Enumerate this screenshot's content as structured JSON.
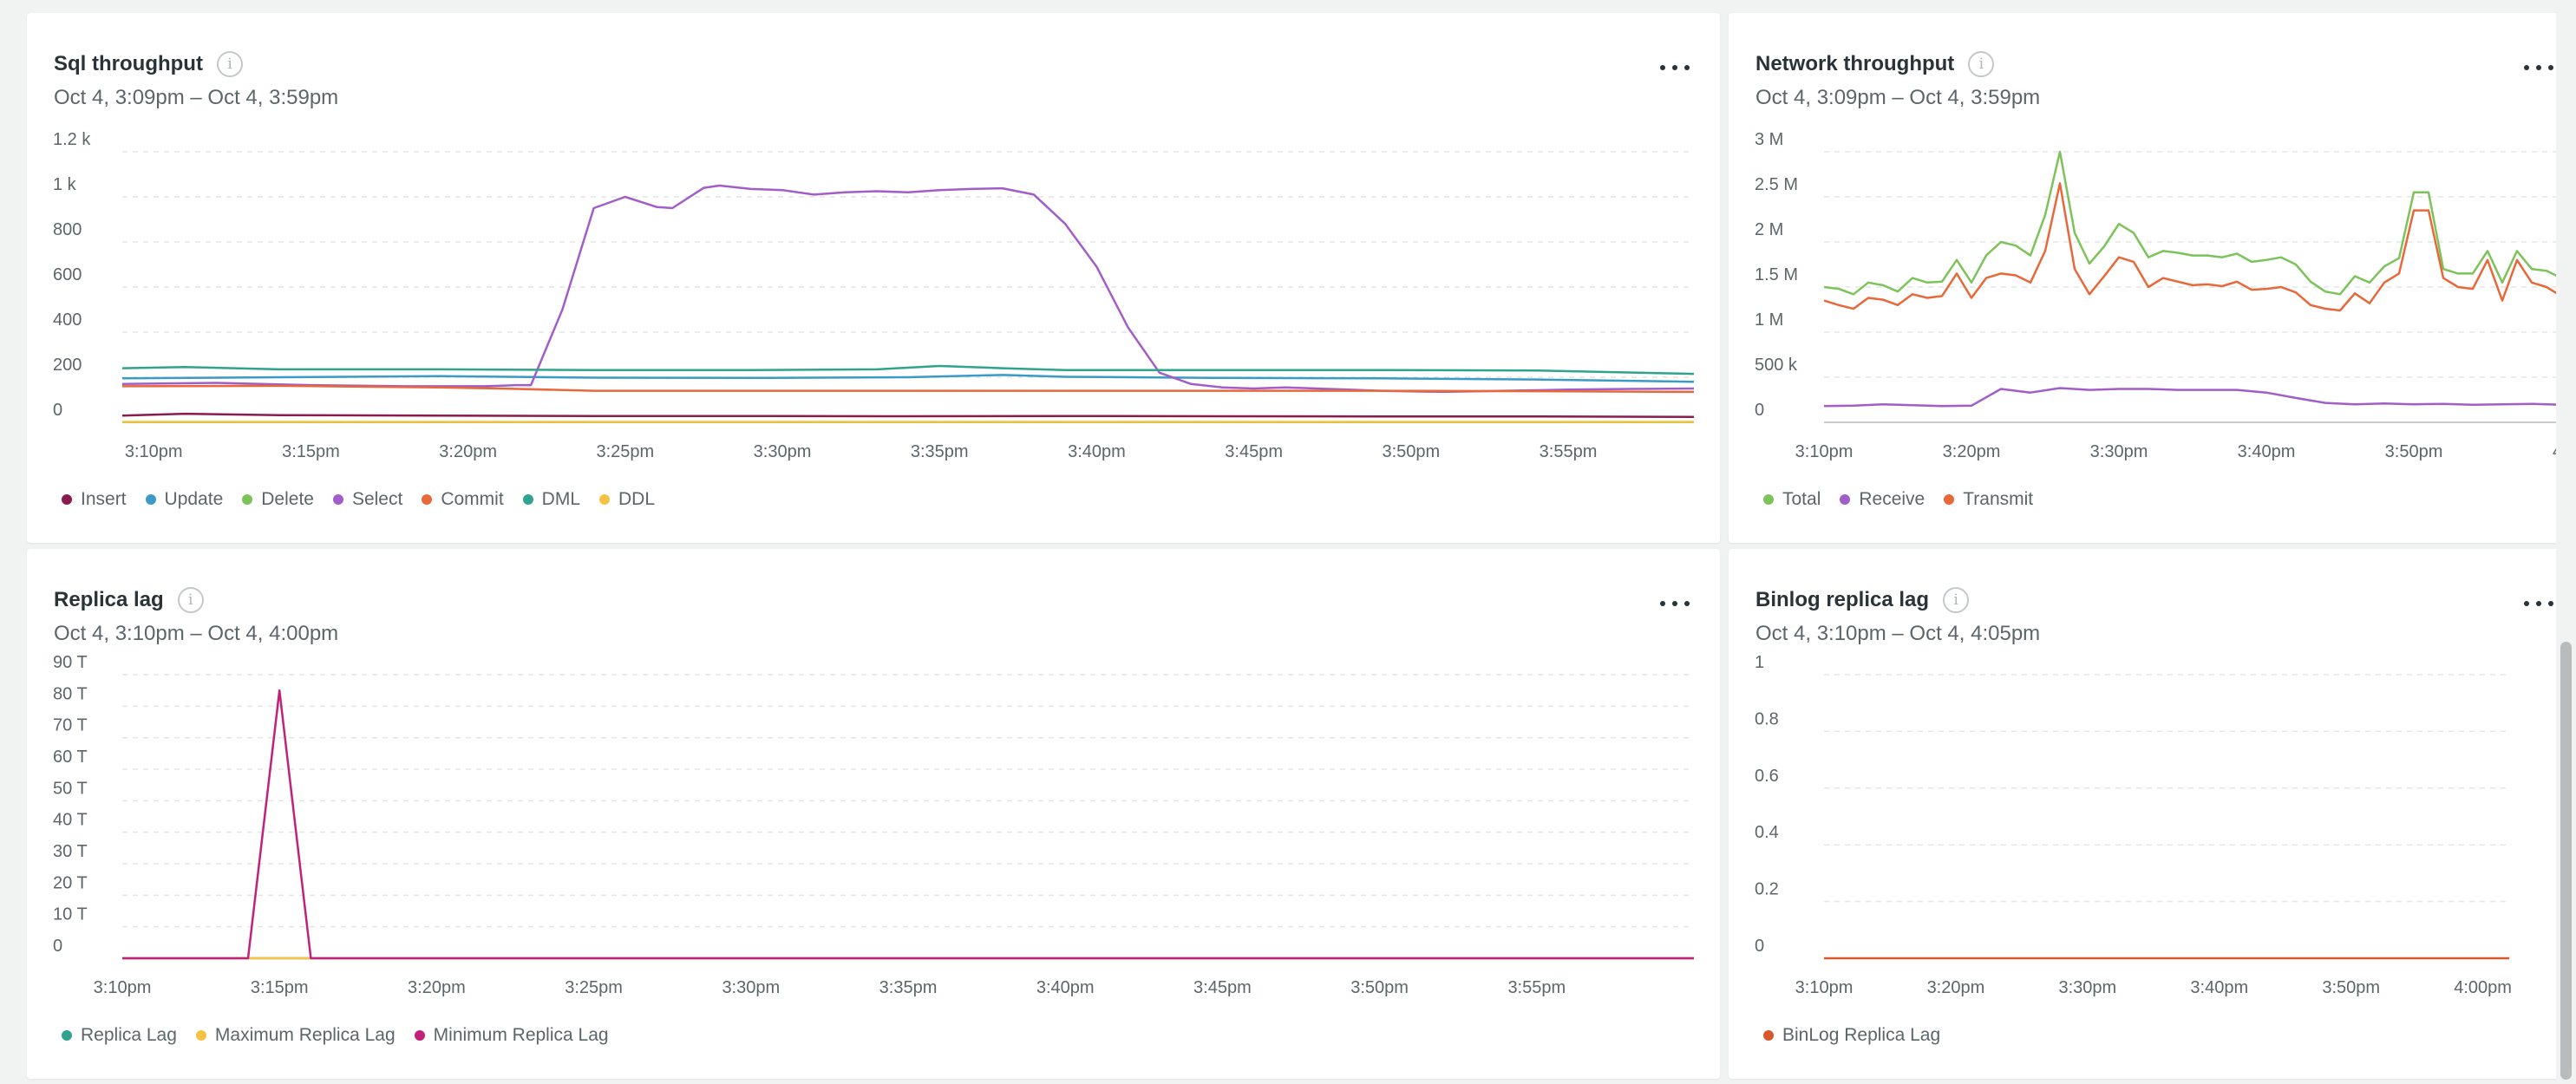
{
  "panels": {
    "sql": {
      "title": "Sql throughput",
      "subtitle": "Oct 4, 3:09pm – Oct 4, 3:59pm"
    },
    "network": {
      "title": "Network throughput",
      "subtitle": "Oct 4, 3:09pm – Oct 4, 3:59pm"
    },
    "replica": {
      "title": "Replica lag",
      "subtitle": "Oct 4, 3:10pm – Oct 4, 4:00pm"
    },
    "binlog": {
      "title": "Binlog replica lag",
      "subtitle": "Oct 4, 3:10pm – Oct 4, 4:05pm"
    }
  },
  "icons": {
    "info": "info-icon",
    "more": "more-horizontal-icon"
  },
  "chart_data": [
    {
      "id": "sql",
      "type": "line",
      "ylim": [
        0,
        1200
      ],
      "yticks": [
        0,
        200,
        400,
        600,
        800,
        1000,
        1200
      ],
      "ytick_labels": [
        "0",
        "200",
        "400",
        "600",
        "800",
        "1 k",
        "1.2 k"
      ],
      "xlim": [
        0,
        50
      ],
      "xticks": [
        1,
        6,
        11,
        16,
        21,
        26,
        31,
        36,
        41,
        46
      ],
      "xtick_labels": [
        "3:10pm",
        "3:15pm",
        "3:20pm",
        "3:25pm",
        "3:30pm",
        "3:35pm",
        "3:40pm",
        "3:45pm",
        "3:50pm",
        "3:55pm"
      ],
      "grid": true,
      "series": [
        {
          "name": "Insert",
          "color": "#8b1b4f",
          "x": [
            0,
            2,
            5,
            10,
            15,
            20,
            25,
            30,
            35,
            40,
            45,
            50
          ],
          "y": [
            30,
            38,
            32,
            30,
            28,
            28,
            27,
            28,
            27,
            26,
            26,
            24
          ]
        },
        {
          "name": "Update",
          "color": "#3b9ac6",
          "x": [
            0,
            5,
            10,
            15,
            20,
            25,
            28,
            30,
            35,
            40,
            45,
            50
          ],
          "y": [
            195,
            200,
            205,
            198,
            197,
            200,
            210,
            202,
            197,
            195,
            190,
            180
          ]
        },
        {
          "name": "Delete",
          "color": "#7cc35a",
          "x": [
            0,
            50
          ],
          "y": [
            1,
            1
          ]
        },
        {
          "name": "Select",
          "color": "#a25ec8",
          "x": [
            0,
            3,
            6,
            9,
            11.5,
            12,
            12.5,
            13,
            14,
            15,
            16,
            17,
            17.5,
            18.5,
            19,
            20,
            21,
            22,
            23,
            24,
            25,
            26,
            27,
            28,
            29,
            30,
            31,
            32,
            33,
            34,
            35,
            36,
            37,
            38,
            39,
            40,
            42,
            44,
            46,
            48,
            50
          ],
          "y": [
            170,
            175,
            165,
            160,
            160,
            162,
            165,
            165,
            500,
            950,
            1000,
            955,
            950,
            1040,
            1050,
            1035,
            1030,
            1010,
            1020,
            1025,
            1020,
            1030,
            1035,
            1038,
            1010,
            880,
            690,
            420,
            220,
            170,
            155,
            150,
            155,
            150,
            145,
            140,
            135,
            140,
            145,
            148,
            150
          ]
        },
        {
          "name": "Commit",
          "color": "#e8683a",
          "x": [
            0,
            5,
            10,
            12,
            15,
            20,
            25,
            30,
            35,
            40,
            45,
            50
          ],
          "y": [
            160,
            162,
            155,
            150,
            140,
            140,
            140,
            140,
            140,
            140,
            138,
            135
          ]
        },
        {
          "name": "DML",
          "color": "#2fa38e",
          "x": [
            0,
            2,
            5,
            10,
            15,
            20,
            24,
            26,
            28,
            30,
            35,
            40,
            45,
            50
          ],
          "y": [
            240,
            245,
            235,
            235,
            232,
            232,
            235,
            250,
            240,
            232,
            232,
            232,
            230,
            215
          ]
        },
        {
          "name": "DDL",
          "color": "#f5c242",
          "x": [
            0,
            50
          ],
          "y": [
            2,
            2
          ]
        }
      ]
    },
    {
      "id": "network",
      "type": "line",
      "ylim": [
        0,
        3000000
      ],
      "yticks": [
        0,
        500000,
        1000000,
        1500000,
        2000000,
        2500000,
        3000000
      ],
      "ytick_labels": [
        "0",
        "500 k",
        "1 M",
        "1.5 M",
        "2 M",
        "2.5 M",
        "3 M"
      ],
      "xlim": [
        0,
        50
      ],
      "xticks": [
        0,
        10,
        20,
        30,
        40
      ],
      "xtick_labels": [
        "3:10pm",
        "3:20pm",
        "3:30pm",
        "3:40pm",
        "3:50pm"
      ],
      "extra_clipped_tick_label": "4:",
      "grid": true,
      "series": [
        {
          "name": "Total",
          "color": "#7cc35a",
          "x": [
            0,
            1,
            2,
            3,
            4,
            5,
            6,
            7,
            8,
            9,
            10,
            11,
            12,
            13,
            14,
            15,
            16,
            17,
            18,
            19,
            20,
            21,
            22,
            23,
            24,
            25,
            26,
            27,
            28,
            29,
            30,
            31,
            32,
            33,
            34,
            35,
            36,
            37,
            38,
            39,
            40,
            41,
            42,
            43,
            44,
            45,
            46,
            47,
            48,
            49,
            50
          ],
          "y": [
            1500000,
            1480000,
            1420000,
            1550000,
            1520000,
            1450000,
            1600000,
            1550000,
            1560000,
            1800000,
            1550000,
            1850000,
            2000000,
            1960000,
            1850000,
            2300000,
            3000000,
            2100000,
            1760000,
            1950000,
            2200000,
            2100000,
            1830000,
            1900000,
            1880000,
            1850000,
            1850000,
            1830000,
            1870000,
            1780000,
            1800000,
            1830000,
            1750000,
            1560000,
            1450000,
            1420000,
            1620000,
            1550000,
            1730000,
            1820000,
            2550000,
            2550000,
            1700000,
            1650000,
            1650000,
            1900000,
            1550000,
            1900000,
            1700000,
            1680000,
            1600000
          ]
        },
        {
          "name": "Receive",
          "color": "#a25ec8",
          "x": [
            0,
            2,
            4,
            6,
            8,
            10,
            12,
            14,
            16,
            18,
            20,
            22,
            24,
            26,
            28,
            30,
            32,
            34,
            36,
            38,
            40,
            42,
            44,
            46,
            48,
            50
          ],
          "y": [
            180000,
            185000,
            200000,
            190000,
            180000,
            185000,
            370000,
            330000,
            380000,
            360000,
            370000,
            370000,
            360000,
            360000,
            360000,
            330000,
            270000,
            215000,
            200000,
            210000,
            200000,
            205000,
            195000,
            200000,
            205000,
            195000
          ]
        },
        {
          "name": "Transmit",
          "color": "#e8683a",
          "x": [
            0,
            1,
            2,
            3,
            4,
            5,
            6,
            7,
            8,
            9,
            10,
            11,
            12,
            13,
            14,
            15,
            16,
            17,
            18,
            19,
            20,
            21,
            22,
            23,
            24,
            25,
            26,
            27,
            28,
            29,
            30,
            31,
            32,
            33,
            34,
            35,
            36,
            37,
            38,
            39,
            40,
            41,
            42,
            43,
            44,
            45,
            46,
            47,
            48,
            49,
            50
          ],
          "y": [
            1350000,
            1300000,
            1260000,
            1380000,
            1360000,
            1300000,
            1420000,
            1380000,
            1400000,
            1650000,
            1380000,
            1600000,
            1650000,
            1630000,
            1550000,
            1900000,
            2650000,
            1700000,
            1420000,
            1620000,
            1830000,
            1780000,
            1500000,
            1600000,
            1560000,
            1520000,
            1530000,
            1510000,
            1560000,
            1470000,
            1480000,
            1500000,
            1440000,
            1300000,
            1260000,
            1240000,
            1430000,
            1320000,
            1550000,
            1650000,
            2350000,
            2350000,
            1600000,
            1500000,
            1480000,
            1800000,
            1350000,
            1800000,
            1550000,
            1500000,
            1400000
          ]
        }
      ]
    },
    {
      "id": "replica",
      "type": "line",
      "ylim": [
        0,
        90
      ],
      "yticks": [
        0,
        10,
        20,
        30,
        40,
        50,
        60,
        70,
        80,
        90
      ],
      "ytick_labels": [
        "0",
        "10 T",
        "20 T",
        "30 T",
        "40 T",
        "50 T",
        "60 T",
        "70 T",
        "80 T",
        "90 T"
      ],
      "xlim": [
        0,
        50
      ],
      "xticks": [
        0,
        5,
        10,
        15,
        20,
        25,
        30,
        35,
        40,
        45
      ],
      "xtick_labels": [
        "3:10pm",
        "3:15pm",
        "3:20pm",
        "3:25pm",
        "3:30pm",
        "3:35pm",
        "3:40pm",
        "3:45pm",
        "3:50pm",
        "3:55pm"
      ],
      "grid": true,
      "series": [
        {
          "name": "Replica Lag",
          "color": "#2fa38e",
          "x": [
            0,
            50
          ],
          "y": [
            0,
            0
          ]
        },
        {
          "name": "Maximum Replica Lag",
          "color": "#f5c242",
          "x": [
            0,
            50
          ],
          "y": [
            0,
            0
          ]
        },
        {
          "name": "Minimum Replica Lag",
          "color": "#c2217a",
          "x": [
            0,
            4,
            5,
            6,
            50
          ],
          "y": [
            0,
            0,
            85,
            0,
            0
          ]
        }
      ]
    },
    {
      "id": "binlog",
      "type": "line",
      "ylim": [
        0,
        1
      ],
      "yticks": [
        0,
        0.2,
        0.4,
        0.6,
        0.8,
        1
      ],
      "ytick_labels": [
        "0",
        "0.2",
        "0.4",
        "0.6",
        "0.8",
        "1"
      ],
      "xlim": [
        0,
        52
      ],
      "xticks": [
        0,
        10,
        20,
        30,
        40,
        50
      ],
      "xtick_labels": [
        "3:10pm",
        "3:20pm",
        "3:30pm",
        "3:40pm",
        "3:50pm",
        "4:00pm"
      ],
      "grid": true,
      "series": [
        {
          "name": "BinLog Replica Lag",
          "color": "#d9582b",
          "x": [
            0,
            52
          ],
          "y": [
            0,
            0
          ]
        }
      ]
    }
  ]
}
